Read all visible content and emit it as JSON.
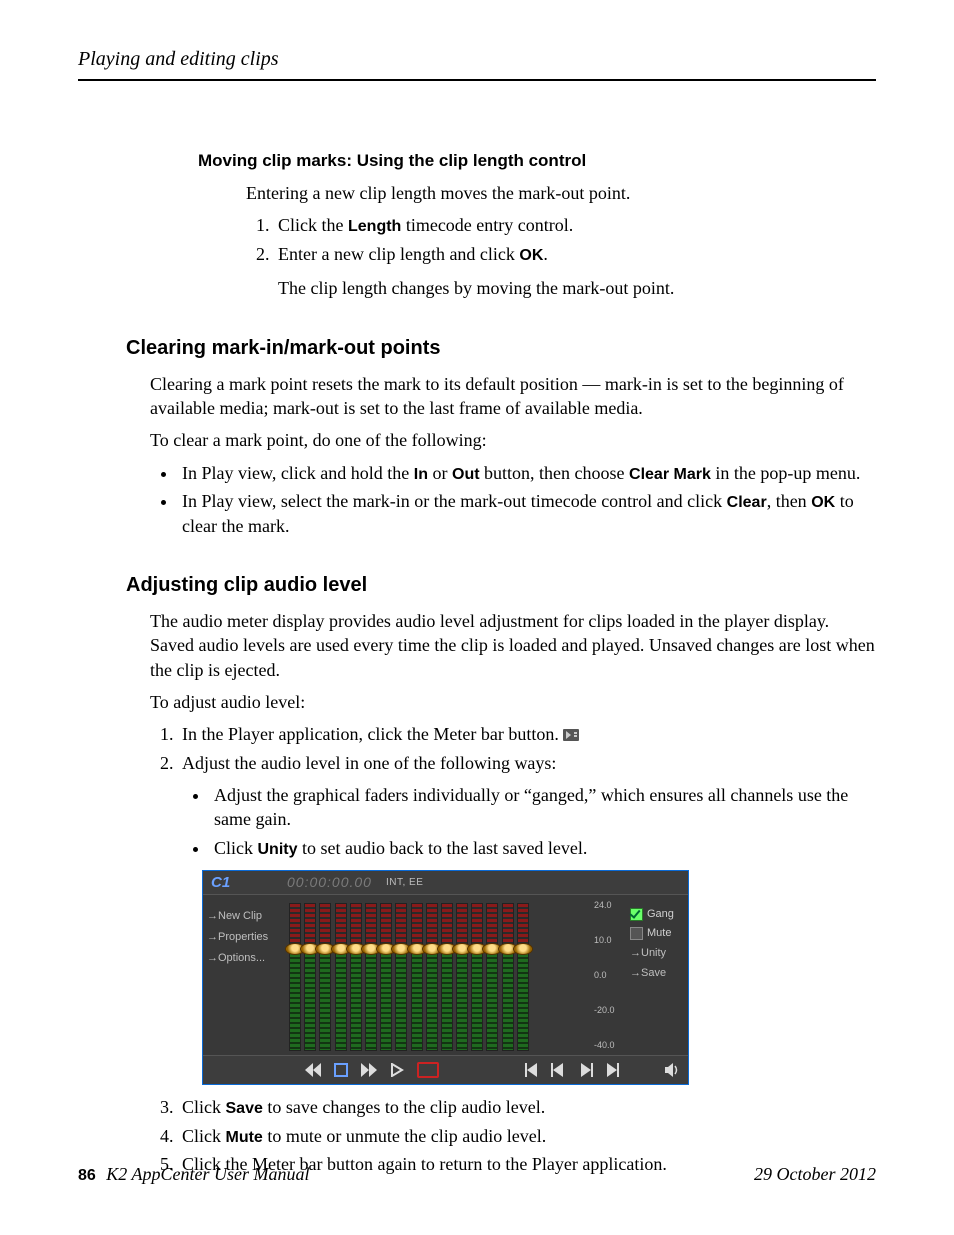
{
  "header": {
    "running_head": "Playing and editing clips"
  },
  "s1": {
    "heading": "Moving clip marks: Using the clip length control",
    "intro": "Entering a new clip length moves the mark-out point.",
    "step1_pre": "Click the ",
    "step1_ui": "Length",
    "step1_post": " timecode entry control.",
    "step2_pre": "Enter a new clip length and click ",
    "step2_ui": "OK",
    "step2_post": ".",
    "result": "The clip length changes by moving the mark-out point."
  },
  "s2": {
    "heading": "Clearing mark-in/mark-out points",
    "p1": "Clearing a mark point resets the mark to its default position — mark-in is set to the beginning of available media; mark-out is set to the last frame of available media.",
    "p2": "To clear a mark point, do one of the following:",
    "b1_pre": "In Play view, click and hold the ",
    "b1_ui1": "In",
    "b1_mid": " or ",
    "b1_ui2": "Out",
    "b1_mid2": " button, then choose ",
    "b1_ui3": "Clear Mark",
    "b1_post": " in the pop-up menu.",
    "b2_pre": "In Play view, select the mark-in or the mark-out timecode control and click ",
    "b2_ui1": "Clear",
    "b2_mid": ", then ",
    "b2_ui2": "OK",
    "b2_post": " to clear the mark."
  },
  "s3": {
    "heading": "Adjusting clip audio level",
    "p1": "The audio meter display provides audio level adjustment for clips loaded in the player display. Saved audio levels are used every time the clip is loaded and played. Unsaved changes are lost when the clip is ejected.",
    "p2": "To adjust audio level:",
    "step1": "In the Player application, click the Meter bar button. ",
    "step2": "Adjust the audio level in one of the following ways:",
    "sub_a": "Adjust the graphical faders individually or “ganged,” which ensures all channels use the same gain.",
    "sub_b_pre": "Click ",
    "sub_b_ui": "Unity",
    "sub_b_post": "  to set audio back to the last saved level.",
    "step3_pre": "Click ",
    "step3_ui": "Save",
    "step3_post": " to save changes to the clip audio level.",
    "step4_pre": "Click ",
    "step4_ui": "Mute",
    "step4_post": " to mute or unmute the clip audio level.",
    "step5": "Click the Meter bar button again to return to the Player application."
  },
  "shot": {
    "channel": "C1",
    "timecode": "00:00:00.00",
    "mode": "INT, EE",
    "left": {
      "new_clip": "→New Clip",
      "properties": "→Properties",
      "options": "→Options..."
    },
    "scale": {
      "v1": "24.0",
      "v2": "10.0",
      "v3": "0.0",
      "v4": "-20.0",
      "v5": "-40.0"
    },
    "right": {
      "gang": "Gang",
      "mute": "Mute",
      "unity": "→Unity",
      "save": "→Save"
    }
  },
  "footer": {
    "page": "86",
    "manual": "K2 AppCenter User Manual",
    "date": "29 October 2012"
  }
}
